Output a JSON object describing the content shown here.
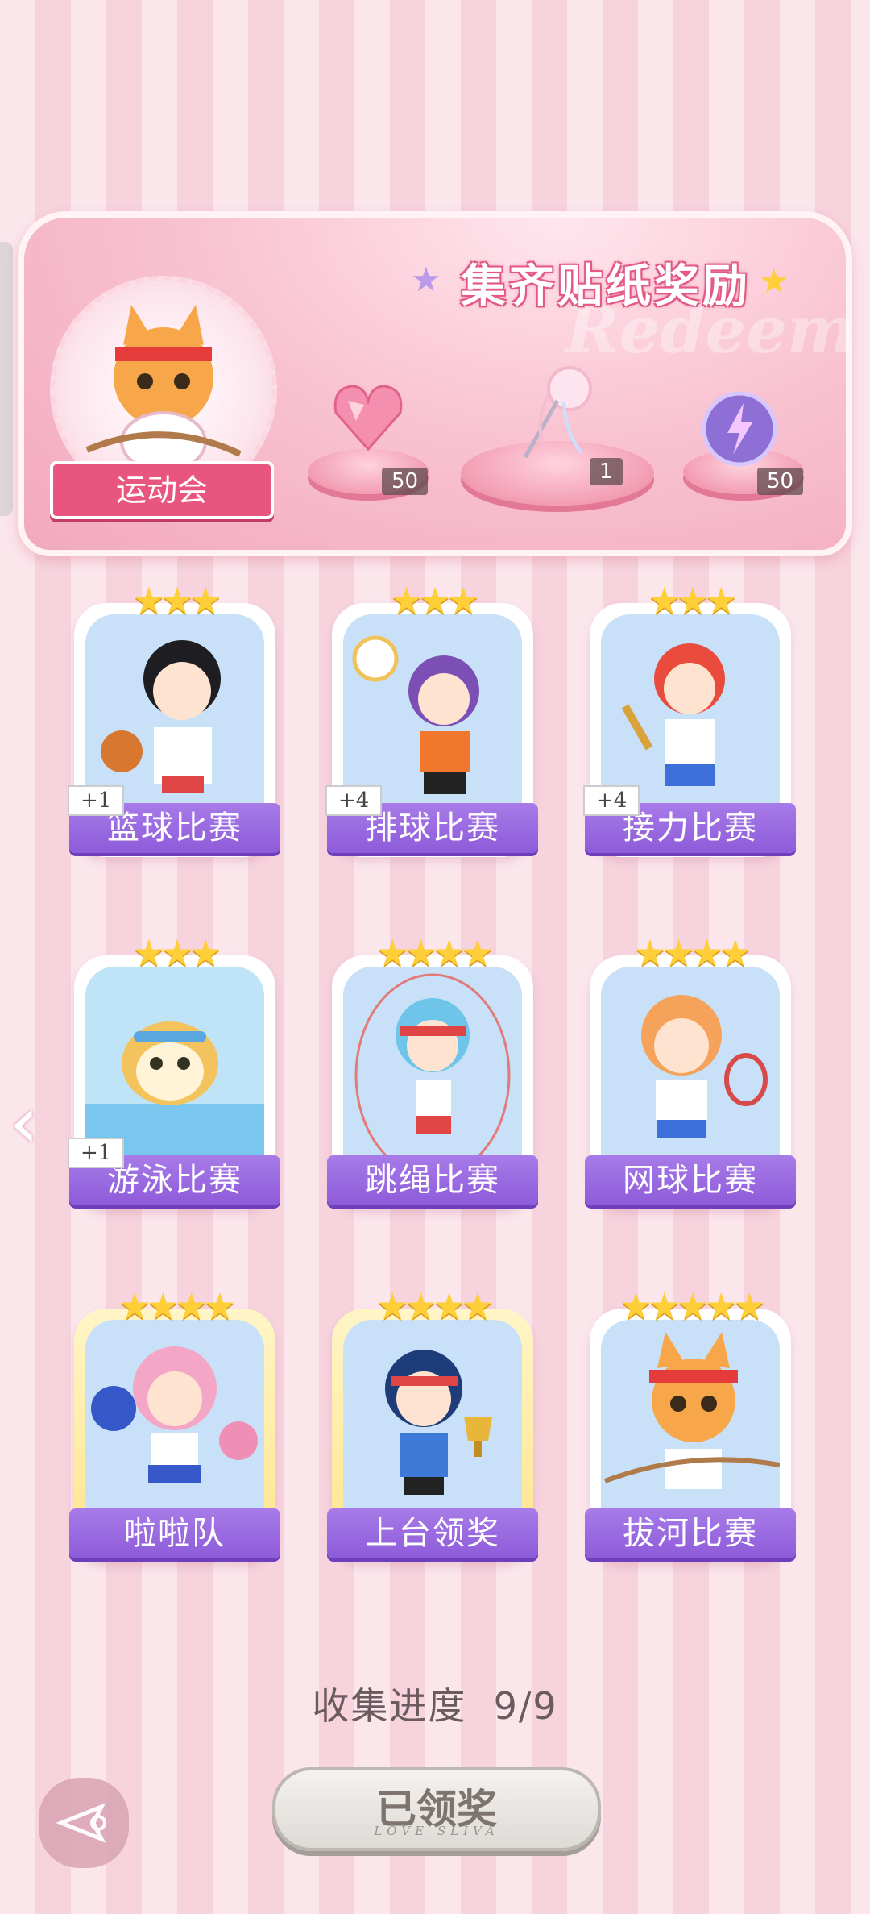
{
  "banner": {
    "title": "集齐贴纸奖励",
    "watermark": "Redeem",
    "event_label": "运动会",
    "rewards": [
      {
        "icon": "heart-gem-icon",
        "count": "50"
      },
      {
        "icon": "ribbon-bouquet-icon",
        "count": "1"
      },
      {
        "icon": "lightning-orb-icon",
        "count": "50"
      }
    ]
  },
  "cards": [
    {
      "label": "篮球比赛",
      "stars": "★★★",
      "bonus": "+1",
      "icon": "basketball-girl-icon"
    },
    {
      "label": "排球比赛",
      "stars": "★★★",
      "bonus": "+4",
      "icon": "volleyball-girl-icon"
    },
    {
      "label": "接力比赛",
      "stars": "★★★",
      "bonus": "+4",
      "icon": "relay-runner-icon"
    },
    {
      "label": "游泳比赛",
      "stars": "★★★",
      "bonus": "+1",
      "icon": "swimming-dog-icon"
    },
    {
      "label": "跳绳比赛",
      "stars": "★★★★",
      "bonus": "",
      "icon": "jump-rope-girl-icon"
    },
    {
      "label": "网球比赛",
      "stars": "★★★★",
      "bonus": "",
      "icon": "tennis-girl-icon"
    },
    {
      "label": "啦啦队",
      "stars": "★★★★",
      "bonus": "",
      "icon": "cheerleader-icon"
    },
    {
      "label": "上台领奖",
      "stars": "★★★★",
      "bonus": "",
      "icon": "trophy-girl-icon"
    },
    {
      "label": "拔河比赛",
      "stars": "★★★★★",
      "bonus": "",
      "icon": "tug-of-war-cat-icon"
    }
  ],
  "progress_label": "收集进度",
  "progress_value": "9/9",
  "claim_button": {
    "label": "已领奖",
    "sub": "LOVE SLIVA"
  },
  "colors": {
    "accent_purple": "#8e5bd9",
    "accent_pink": "#e8557f",
    "star_gold": "#ffcf3a"
  }
}
